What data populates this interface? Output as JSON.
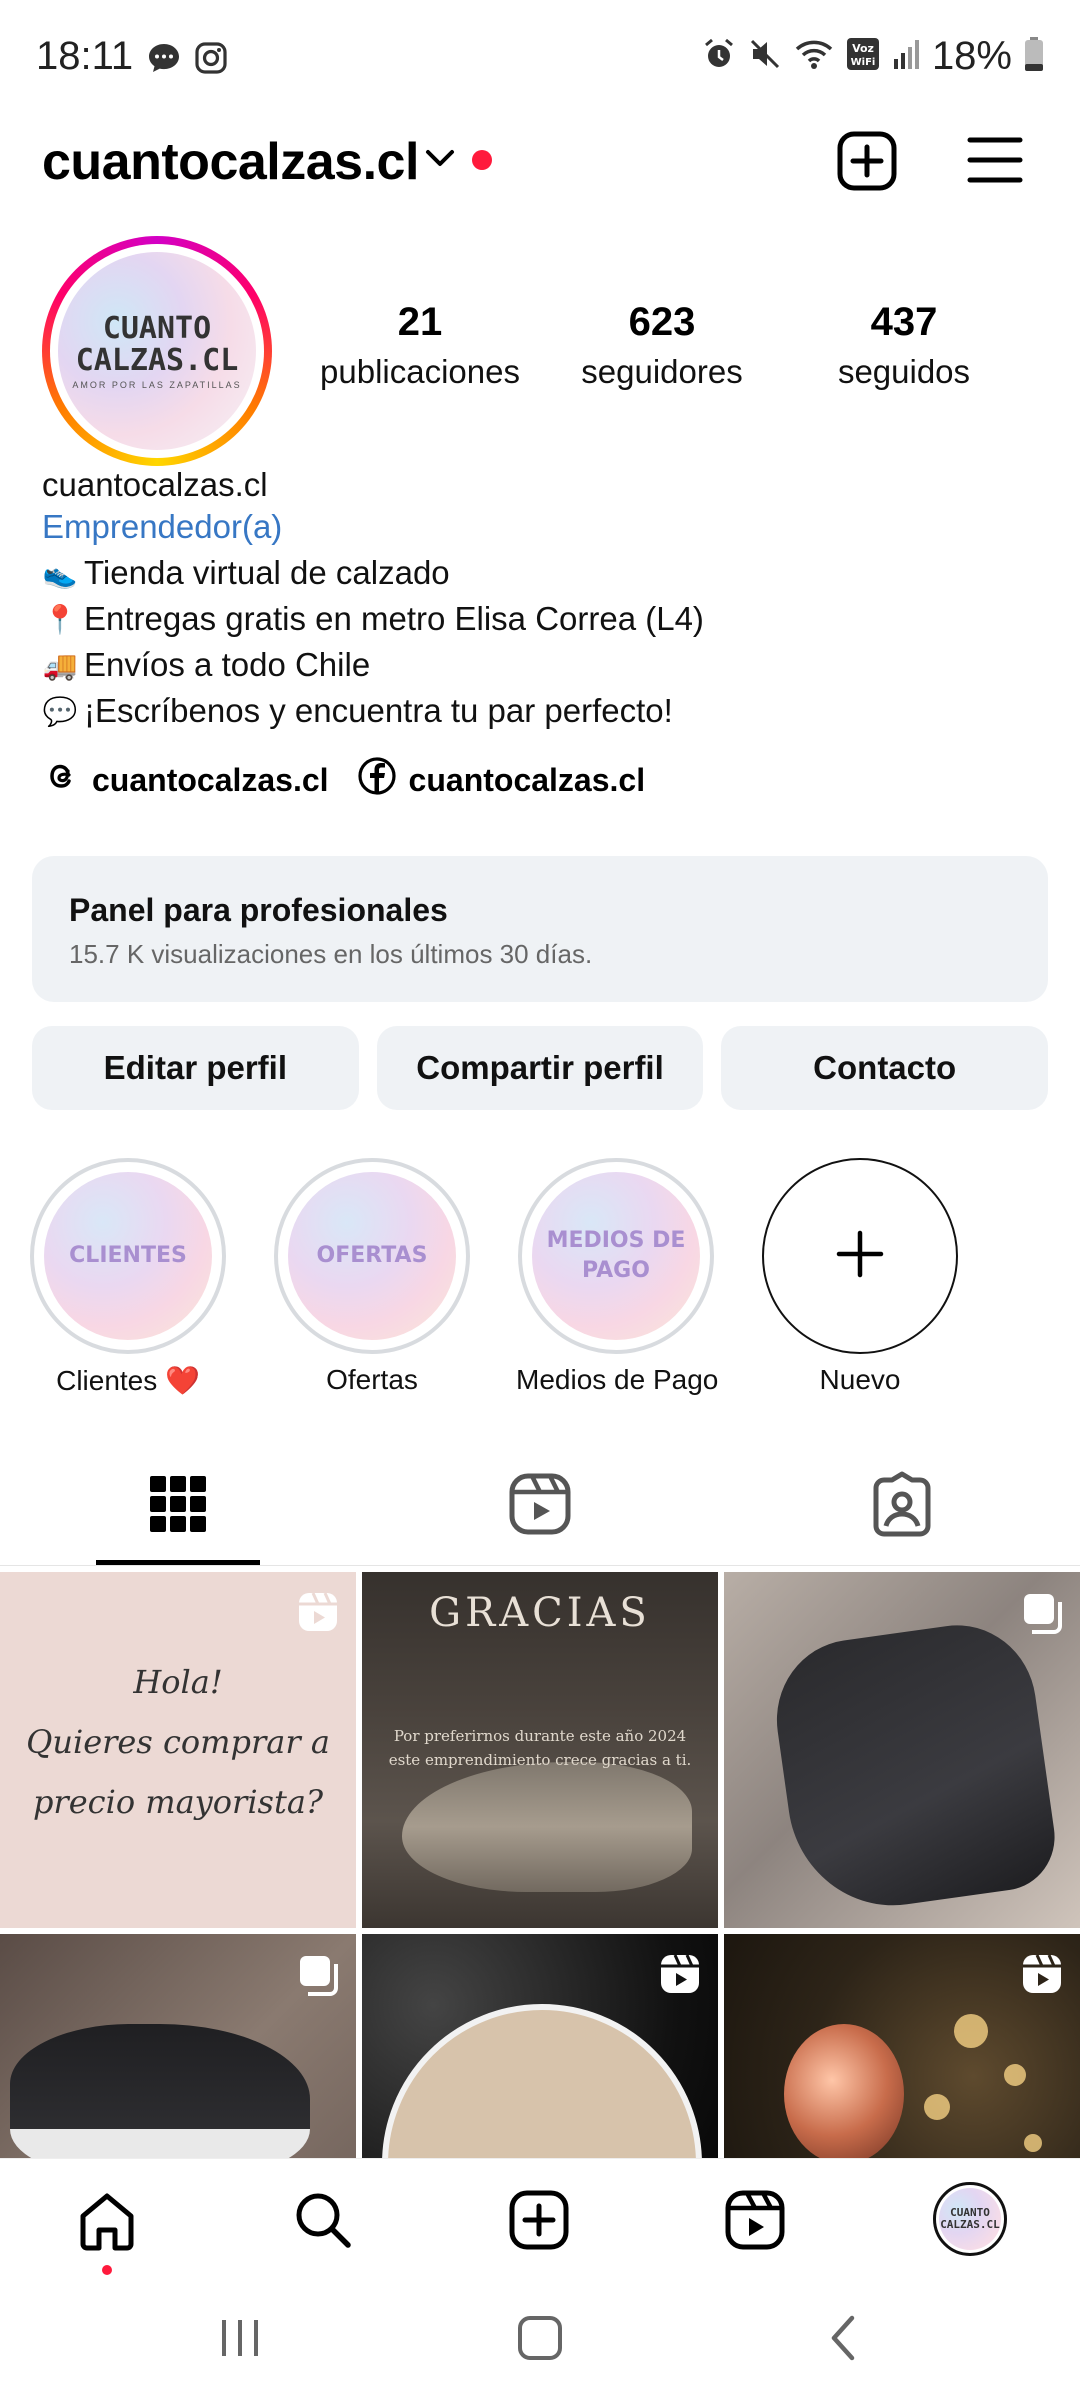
{
  "status_bar": {
    "time": "18:11",
    "left_icons": [
      "chat-bubble-icon",
      "instagram-icon"
    ],
    "right_icons": [
      "alarm-icon",
      "mute-icon",
      "wifi-icon",
      "volte-icon",
      "signal-icon",
      "battery-icon"
    ],
    "volte_label": "Voz\nWiFi",
    "battery": "18%"
  },
  "header": {
    "username": "cuantocalzas.cl",
    "has_notification_dot": true
  },
  "profile": {
    "avatar_text": "CUANTO\nCALZAS.CL",
    "avatar_sub": "AMOR POR LAS ZAPATILLAS",
    "stats": [
      {
        "number": "21",
        "label": "publicaciones"
      },
      {
        "number": "623",
        "label": "seguidores"
      },
      {
        "number": "437",
        "label": "seguidos"
      }
    ],
    "name": "cuantocalzas.cl",
    "category": "Emprendedor(a)",
    "bio_lines": [
      {
        "emoji": "👟",
        "text": "Tienda virtual de calzado"
      },
      {
        "emoji": "📍",
        "text": "Entregas gratis en metro Elisa Correa (L4)"
      },
      {
        "emoji": "🚚",
        "text": " Envíos a todo Chile"
      },
      {
        "emoji": "💬",
        "text": " ¡Escríbenos y encuentra tu par perfecto!"
      }
    ],
    "links": [
      {
        "icon": "threads-icon",
        "text": "cuantocalzas.cl"
      },
      {
        "icon": "facebook-icon",
        "text": "cuantocalzas.cl"
      }
    ]
  },
  "panel": {
    "title": "Panel para profesionales",
    "subtitle": "15.7 K visualizaciones en los últimos 30 días."
  },
  "buttons": {
    "edit": "Editar perfil",
    "share": "Compartir perfil",
    "contact": "Contacto"
  },
  "highlights": [
    {
      "cover": "CLIENTES",
      "label": "Clientes ❤️"
    },
    {
      "cover": "OFERTAS",
      "label": "Ofertas"
    },
    {
      "cover": "MEDIOS DE\nPAGO",
      "label": "Medios de Pago"
    },
    {
      "cover": "",
      "label": "Nuevo"
    }
  ],
  "tabs": [
    "grid-icon",
    "reels-icon",
    "tagged-icon"
  ],
  "posts": {
    "p1_text": "Hola!\nQuieres comprar a\nprecio mayorista?",
    "p2_title": "GRACIAS",
    "p2_sub": "Por preferirnos durante este año 2024\neste emprendimiento crece gracias a ti."
  },
  "bottom_nav": [
    "home-icon",
    "search-icon",
    "create-icon",
    "reels-icon",
    "profile-avatar"
  ],
  "bottom_nav_avatar_text": "CUANTO\nCALZAS.CL",
  "system_nav": [
    "recents-icon",
    "home-button-icon",
    "back-icon"
  ]
}
